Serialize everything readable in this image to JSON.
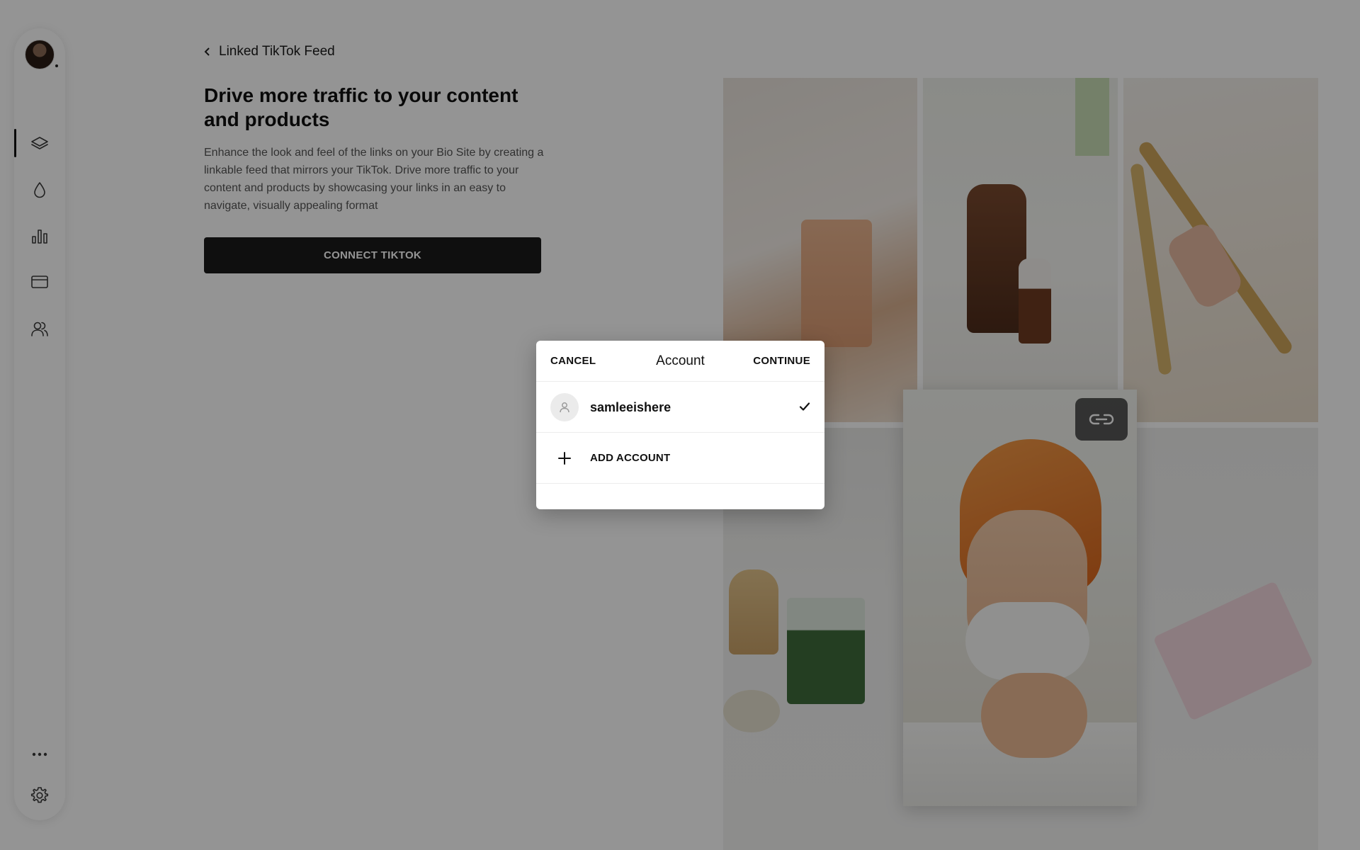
{
  "header": {
    "back_label": "Linked TikTok Feed"
  },
  "main": {
    "headline": "Drive more traffic to your content and products",
    "description": "Enhance the look and feel of the links on your Bio Site by creating a linkable feed that mirrors your TikTok. Drive more traffic to your content and products by showcasing your links in an easy to navigate, visually appealing format",
    "connect_button": "CONNECT TIKTOK"
  },
  "sidebar": {
    "items": [
      {
        "icon": "layers-icon",
        "active": true
      },
      {
        "icon": "droplet-icon",
        "active": false
      },
      {
        "icon": "bar-chart-icon",
        "active": false
      },
      {
        "icon": "card-icon",
        "active": false
      },
      {
        "icon": "users-icon",
        "active": false
      },
      {
        "icon": "more-icon",
        "active": false
      },
      {
        "icon": "gear-icon",
        "active": false
      }
    ]
  },
  "modal": {
    "title": "Account",
    "cancel_label": "CANCEL",
    "continue_label": "CONTINUE",
    "accounts": [
      {
        "username": "samleeishere",
        "selected": true
      }
    ],
    "add_account_label": "ADD ACCOUNT"
  },
  "colors": {
    "accent": "#1a1a1a",
    "overlay": "rgba(0,0,0,0.42)",
    "towel": "#e8782c"
  }
}
